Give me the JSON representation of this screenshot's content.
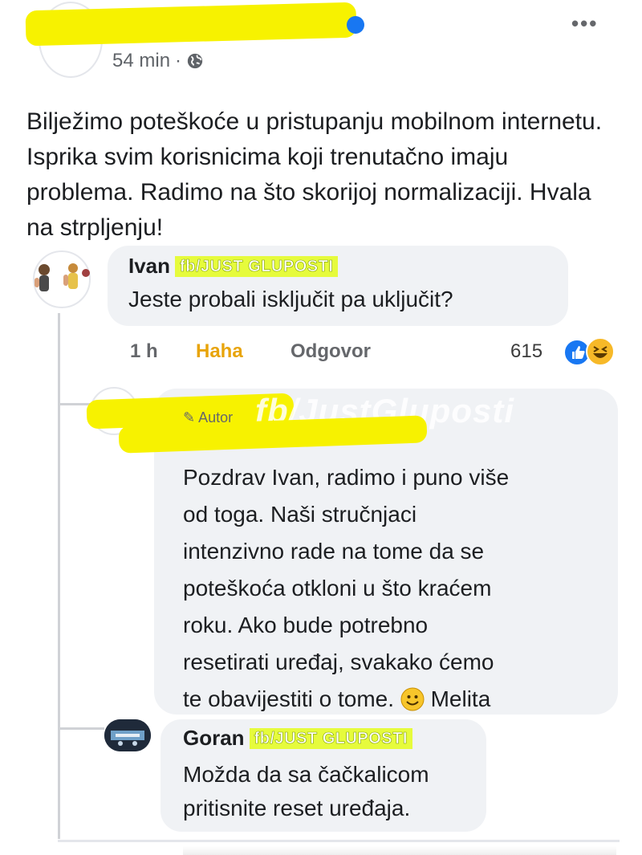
{
  "post": {
    "time": "54 min",
    "separator": "·",
    "text": "Bilježimo poteškoće u pristupanju mobilnom internetu. Isprika svim korisnicima koji trenutačno imaju problema. Radimo na što skorijoj normalizaciji. Hvala na strpljenju!"
  },
  "comments": [
    {
      "author": "Ivan",
      "tag": "fb/JUST GLUPOSTI",
      "text": "Jeste probali isključit pa uključit?",
      "time": "1 h",
      "reaction_label": "Haha",
      "reply_label": "Odgovor",
      "reaction_count": "615"
    },
    {
      "author_hidden": true,
      "edited_label": "✎ Autor",
      "watermark": "fb/JustGluposti",
      "text_lines": [
        "Pozdrav Ivan, radimo i puno više",
        "od toga. Naši stručnjaci",
        "intenzivno rade na tome da se",
        "poteškoća otkloni u što kraćem",
        "roku. Ako bude potrebno",
        "resetirati uređaj, svakako ćemo"
      ],
      "last_line_before_emoji": "te obavijestiti o tome.",
      "last_line_after_emoji": "Melita"
    },
    {
      "author": "Goran",
      "tag": "fb/JUST GLUPOSTI",
      "text_lines": [
        "Možda da sa čačkalicom",
        "pritisnite reset uređaja."
      ]
    }
  ],
  "colors": {
    "redaction": "#f7f200",
    "tag_bg": "#e6fb3c",
    "haha": "#e8a40a",
    "bubble": "#f0f2f5"
  },
  "icons": {
    "globe": "globe-icon",
    "more": "more-options-icon",
    "like": "like-reaction-icon",
    "haha": "haha-reaction-icon",
    "smiley": "smiley-emoji-icon"
  }
}
